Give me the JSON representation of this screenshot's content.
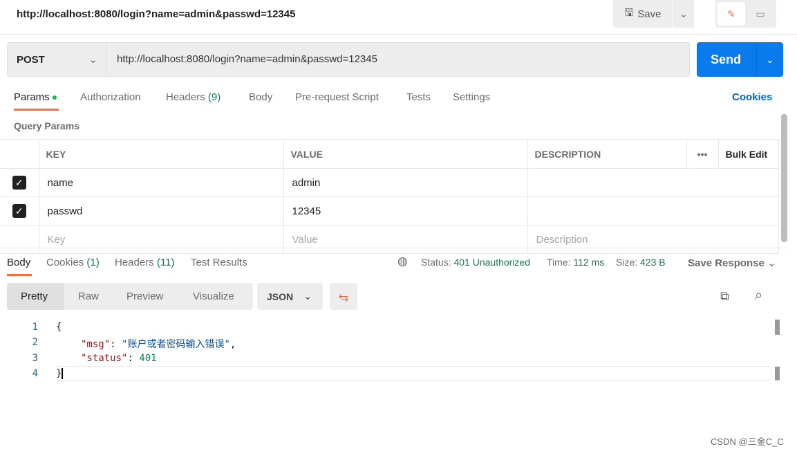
{
  "header": {
    "title": "http://localhost:8080/login?name=admin&passwd=12345",
    "save_label": "Save"
  },
  "request": {
    "method": "POST",
    "url": "http://localhost:8080/login?name=admin&passwd=12345",
    "send_label": "Send"
  },
  "tabs": [
    {
      "label": "Params"
    },
    {
      "label": "Authorization"
    },
    {
      "label": "Headers",
      "count": "(9)"
    },
    {
      "label": "Body"
    },
    {
      "label": "Pre-request Script"
    },
    {
      "label": "Tests"
    },
    {
      "label": "Settings"
    }
  ],
  "cookies_link": "Cookies",
  "query_params": {
    "title": "Query Params",
    "columns": [
      "KEY",
      "VALUE",
      "DESCRIPTION"
    ],
    "more": "•••",
    "bulk_edit": "Bulk Edit",
    "rows": [
      {
        "key": "name",
        "value": "admin",
        "description": ""
      },
      {
        "key": "passwd",
        "value": "12345",
        "description": ""
      }
    ],
    "placeholders": {
      "key": "Key",
      "value": "Value",
      "description": "Description"
    }
  },
  "response": {
    "tabs": [
      {
        "label": "Body"
      },
      {
        "label": "Cookies",
        "count": "(1)"
      },
      {
        "label": "Headers",
        "count": "(11)"
      },
      {
        "label": "Test Results"
      }
    ],
    "status_label": "Status:",
    "status": "401 Unauthorized",
    "time_label": "Time:",
    "time": "112 ms",
    "size_label": "Size:",
    "size": "423 B",
    "save_response": "Save Response",
    "views": [
      "Pretty",
      "Raw",
      "Preview",
      "Visualize"
    ],
    "format": "JSON",
    "lines": [
      "1",
      "2",
      "3",
      "4"
    ],
    "code": {
      "open": "{",
      "k1": "\"msg\"",
      "v1": "\"账户或者密码输入错误\"",
      "k2": "\"status\"",
      "v2": "401",
      "close": "}"
    }
  },
  "watermark": "CSDN @三金C_C"
}
